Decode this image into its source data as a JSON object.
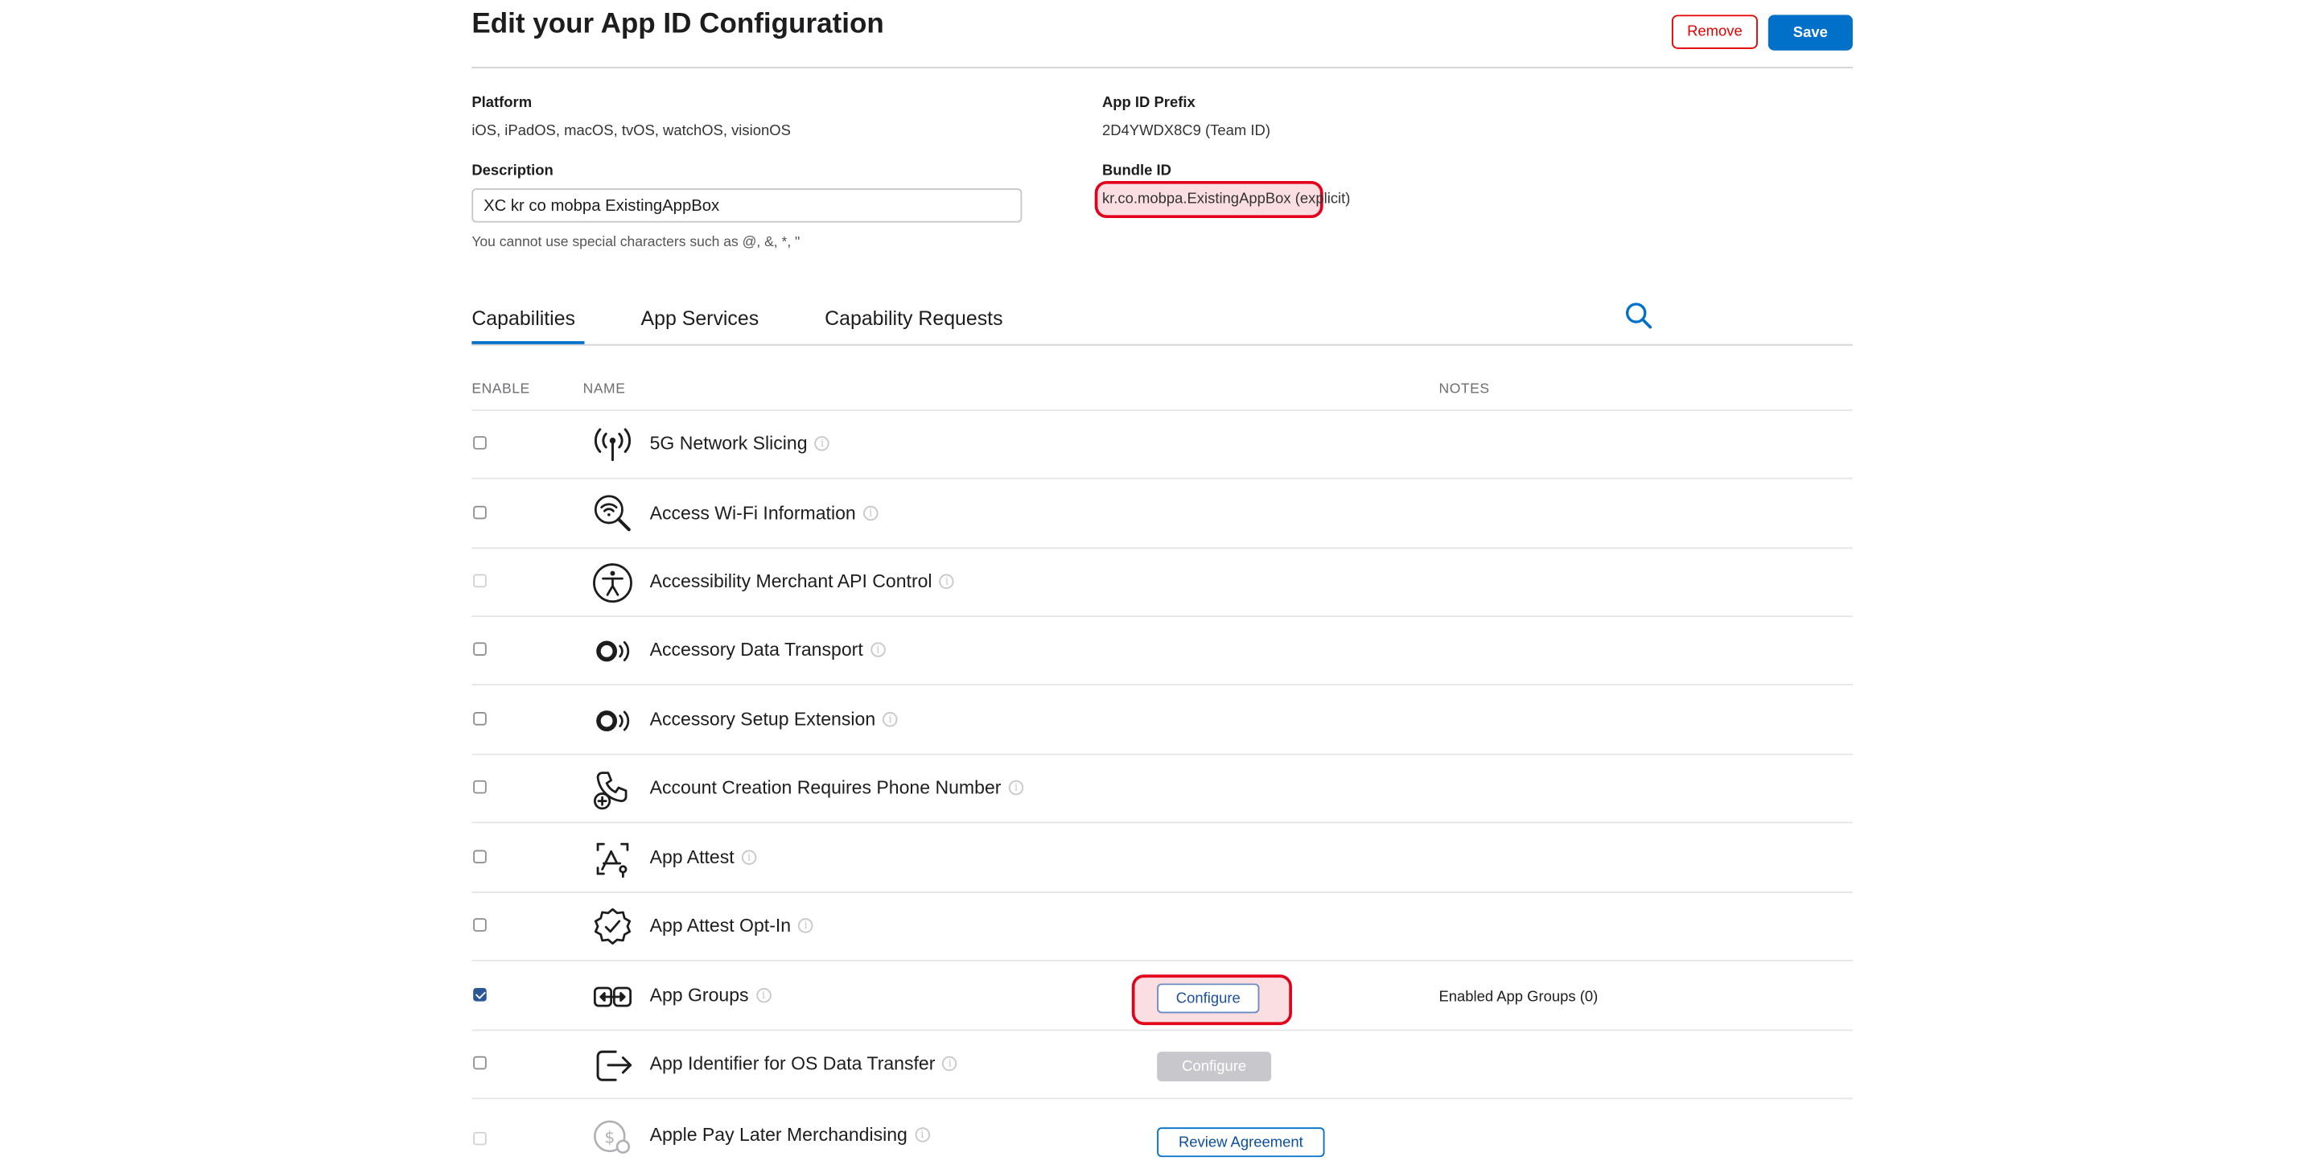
{
  "header": {
    "title": "Edit your App ID Configuration",
    "remove_label": "Remove",
    "save_label": "Save"
  },
  "details": {
    "platform_label": "Platform",
    "platform_value": "iOS, iPadOS, macOS, tvOS, watchOS, visionOS",
    "prefix_label": "App ID Prefix",
    "prefix_value": "2D4YWDX8C9 (Team ID)",
    "description_label": "Description",
    "description_value": "XC kr co mobpa ExistingAppBox",
    "description_hint": "You cannot use special characters such as @, &, *, \"",
    "bundle_label": "Bundle ID",
    "bundle_value": "kr.co.mobpa.ExistingAppBox",
    "bundle_type": "(explicit)"
  },
  "tabs": [
    {
      "label": "Capabilities",
      "active": true
    },
    {
      "label": "App Services",
      "active": false
    },
    {
      "label": "Capability Requests",
      "active": false
    }
  ],
  "columns": {
    "enable": "ENABLE",
    "name": "NAME",
    "notes": "NOTES"
  },
  "capabilities": [
    {
      "name": "5G Network Slicing",
      "icon": "antenna-signal-icon",
      "checked": false
    },
    {
      "name": "Access Wi-Fi Information",
      "icon": "wifi-magnifier-icon",
      "checked": false
    },
    {
      "name": "Accessibility Merchant API Control",
      "icon": "accessibility-icon",
      "checked": false
    },
    {
      "name": "Accessory Data Transport",
      "icon": "accessory-signal-icon",
      "checked": false
    },
    {
      "name": "Accessory Setup Extension",
      "icon": "accessory-signal-icon",
      "checked": false
    },
    {
      "name": "Account Creation Requires Phone Number",
      "icon": "phone-plus-icon",
      "checked": false
    },
    {
      "name": "App Attest",
      "icon": "app-attest-icon",
      "checked": false
    },
    {
      "name": "App Attest Opt-In",
      "icon": "verified-badge-icon",
      "checked": false
    },
    {
      "name": "App Groups",
      "icon": "app-groups-icon",
      "checked": true,
      "action": "Configure",
      "note": "Enabled App Groups (0)"
    },
    {
      "name": "App Identifier for OS Data Transfer",
      "icon": "export-arrow-icon",
      "checked": false,
      "action": "Configure"
    },
    {
      "name": "Apple Pay Later Merchandising",
      "icon": "apple-pay-later-icon",
      "checked": false,
      "action": "Review Agreement"
    }
  ],
  "info_glyph": "i",
  "colors": {
    "accent": "#0070c9",
    "remove": "#e30000",
    "highlight": "#e3001b"
  }
}
